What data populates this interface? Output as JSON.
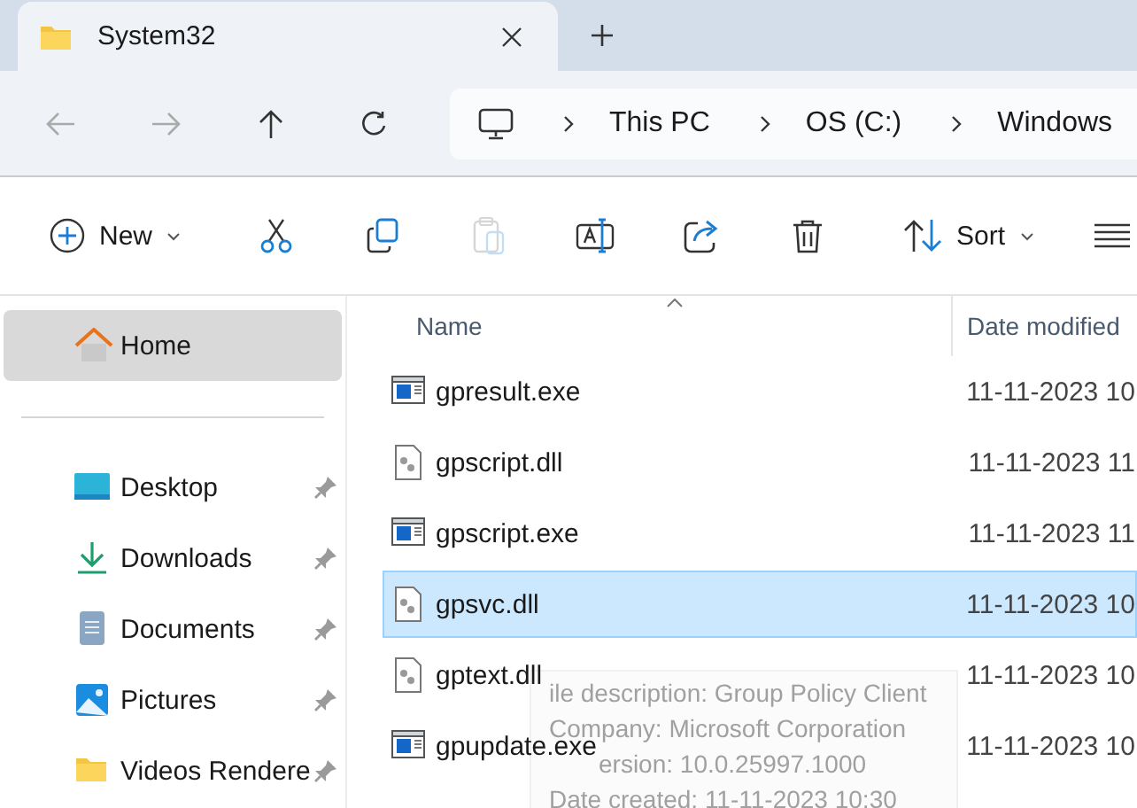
{
  "window": {
    "tabs": [
      {
        "title": "System32",
        "selected": true
      }
    ]
  },
  "address_bar": {
    "segments": [
      "This PC",
      "OS (C:)",
      "Windows"
    ]
  },
  "toolbar": {
    "items": [
      {
        "kind": "new",
        "label": "New",
        "disabled": false
      },
      {
        "kind": "cut",
        "disabled": false
      },
      {
        "kind": "copy",
        "disabled": false
      },
      {
        "kind": "paste",
        "disabled": true
      },
      {
        "kind": "rename",
        "disabled": false
      },
      {
        "kind": "share",
        "disabled": false
      },
      {
        "kind": "delete",
        "disabled": false
      },
      {
        "kind": "sort",
        "label": "Sort",
        "disabled": false
      },
      {
        "kind": "view",
        "disabled": false
      }
    ]
  },
  "sidebar": {
    "home": {
      "label": "Home",
      "selected": true
    },
    "items": [
      {
        "label": "Desktop",
        "kind": "desktop",
        "pinned": true
      },
      {
        "label": "Downloads",
        "kind": "downloads",
        "pinned": true
      },
      {
        "label": "Documents",
        "kind": "documents",
        "pinned": true
      },
      {
        "label": "Pictures",
        "kind": "pictures",
        "pinned": true
      },
      {
        "label": "Videos Rendere",
        "kind": "folder",
        "pinned": true
      }
    ]
  },
  "table": {
    "columns": [
      "Name",
      "Date modified"
    ],
    "rows": [
      {
        "name": "gpresult.exe",
        "kind": "exe",
        "date": "11-11-2023 10",
        "selected": false
      },
      {
        "name": "gpscript.dll",
        "kind": "dll",
        "date": "11-11-2023 11",
        "selected": false
      },
      {
        "name": "gpscript.exe",
        "kind": "exe",
        "date": "11-11-2023 11",
        "selected": false
      },
      {
        "name": "gpsvc.dll",
        "kind": "dll",
        "date": "11-11-2023 10",
        "selected": true
      },
      {
        "name": "gptext.dll",
        "kind": "dll",
        "date": "11-11-2023 10",
        "selected": false
      },
      {
        "name": "gpupdate.exe",
        "kind": "exe",
        "date": "11-11-2023 10",
        "selected": false
      }
    ]
  },
  "tooltip": {
    "lines": [
      "ile description: Group Policy Client",
      "Company: Microsoft Corporation",
      "ersion: 10.0.25997.1000",
      "Date created: 11-11-2023 10:30"
    ]
  }
}
